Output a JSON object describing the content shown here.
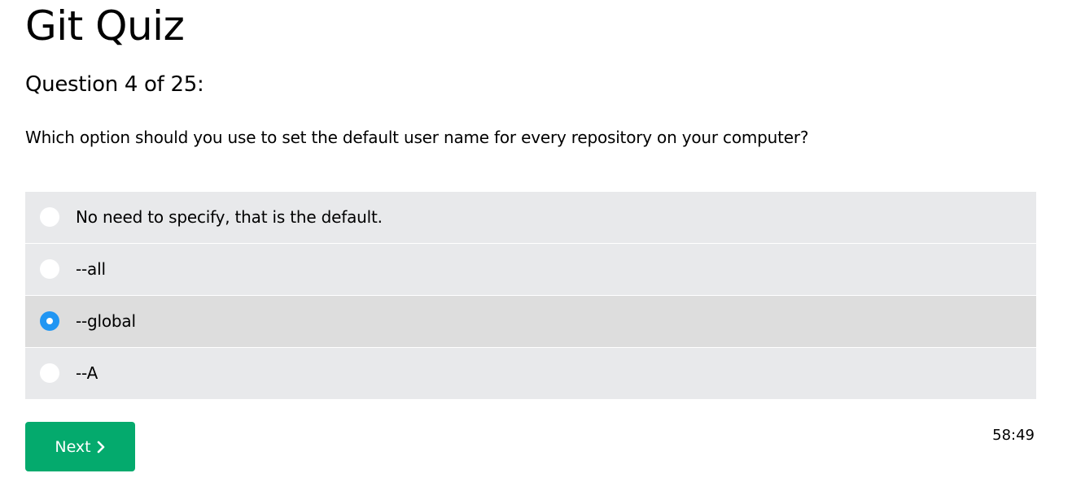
{
  "quiz": {
    "title": "Git Quiz",
    "progress_label": "Question 4 of 25:",
    "question": "Which option should you use to set the default user name for every repository on your computer?",
    "options": [
      {
        "label": "No need to specify, that is the default.",
        "selected": false
      },
      {
        "label": "--all",
        "selected": false
      },
      {
        "label": "--global",
        "selected": true
      },
      {
        "label": "--A",
        "selected": false
      }
    ]
  },
  "controls": {
    "next_label": "Next",
    "timer": "58:49"
  },
  "colors": {
    "accent_green": "#04aa6d",
    "radio_selected": "#2196f3",
    "option_bg": "#e8e9eb",
    "option_selected_bg": "#dddddd"
  },
  "icons": {
    "next": "chevron-right-icon"
  }
}
